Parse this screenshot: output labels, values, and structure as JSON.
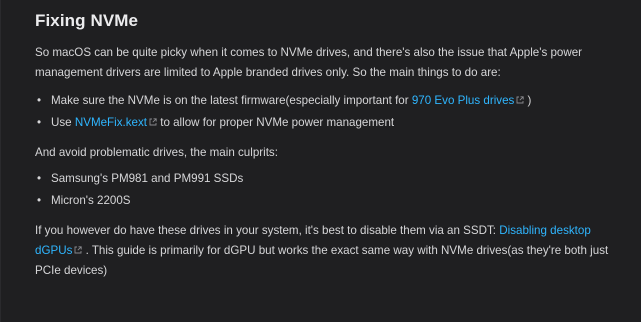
{
  "heading": "Fixing NVMe",
  "intro": "So macOS can be quite picky when it comes to NVMe drives, and there's also the issue that Apple's power management drivers are limited to Apple branded drives only. So the main things to do are:",
  "todo_list": [
    {
      "before": "Make sure the NVMe is on the latest firmware(especially important for ",
      "link": "970 Evo Plus drives",
      "after": " )"
    },
    {
      "before": "Use ",
      "link": "NVMeFix.kext",
      "after": " to allow for proper NVMe power management"
    }
  ],
  "avoid_intro": "And avoid problematic drives, the main culprits:",
  "culprits": [
    "Samsung's PM981 and PM991 SSDs",
    "Micron's 2200S"
  ],
  "final": {
    "before": "If you however do have these drives in your system, it's best to disable them via an SSDT: ",
    "link": "Disabling desktop dGPUs",
    "after": " . This guide is primarily for dGPU but works the exact same way with NVMe drives(as they're both just PCIe devices)"
  },
  "colors": {
    "background": "#1f1f21",
    "text": "#d6d6d8",
    "link": "#2fb6ff",
    "heading": "#ececee"
  },
  "icons": {
    "external_link": "external-link-icon",
    "bullet": "bullet-icon"
  }
}
